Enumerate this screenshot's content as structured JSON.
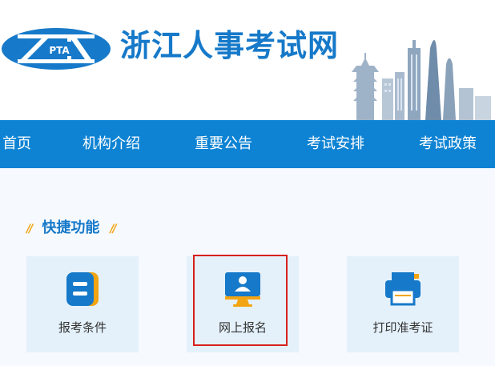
{
  "header": {
    "logo_text": "PTA",
    "site_title": "浙江人事考试网"
  },
  "nav": {
    "items": [
      "首页",
      "机构介绍",
      "重要公告",
      "考试安排",
      "考试政策"
    ]
  },
  "quick": {
    "section_title": "快捷功能",
    "cards": [
      {
        "label": "报考条件",
        "icon": "document-8-icon"
      },
      {
        "label": "网上报名",
        "icon": "monitor-user-icon"
      },
      {
        "label": "打印准考证",
        "icon": "printer-icon"
      }
    ]
  },
  "colors": {
    "brand_blue": "#1679c9",
    "nav_blue": "#0e83d3",
    "accent_orange": "#f2a413",
    "card_bg": "#e4f1fb",
    "highlight_red": "#d9201c"
  }
}
